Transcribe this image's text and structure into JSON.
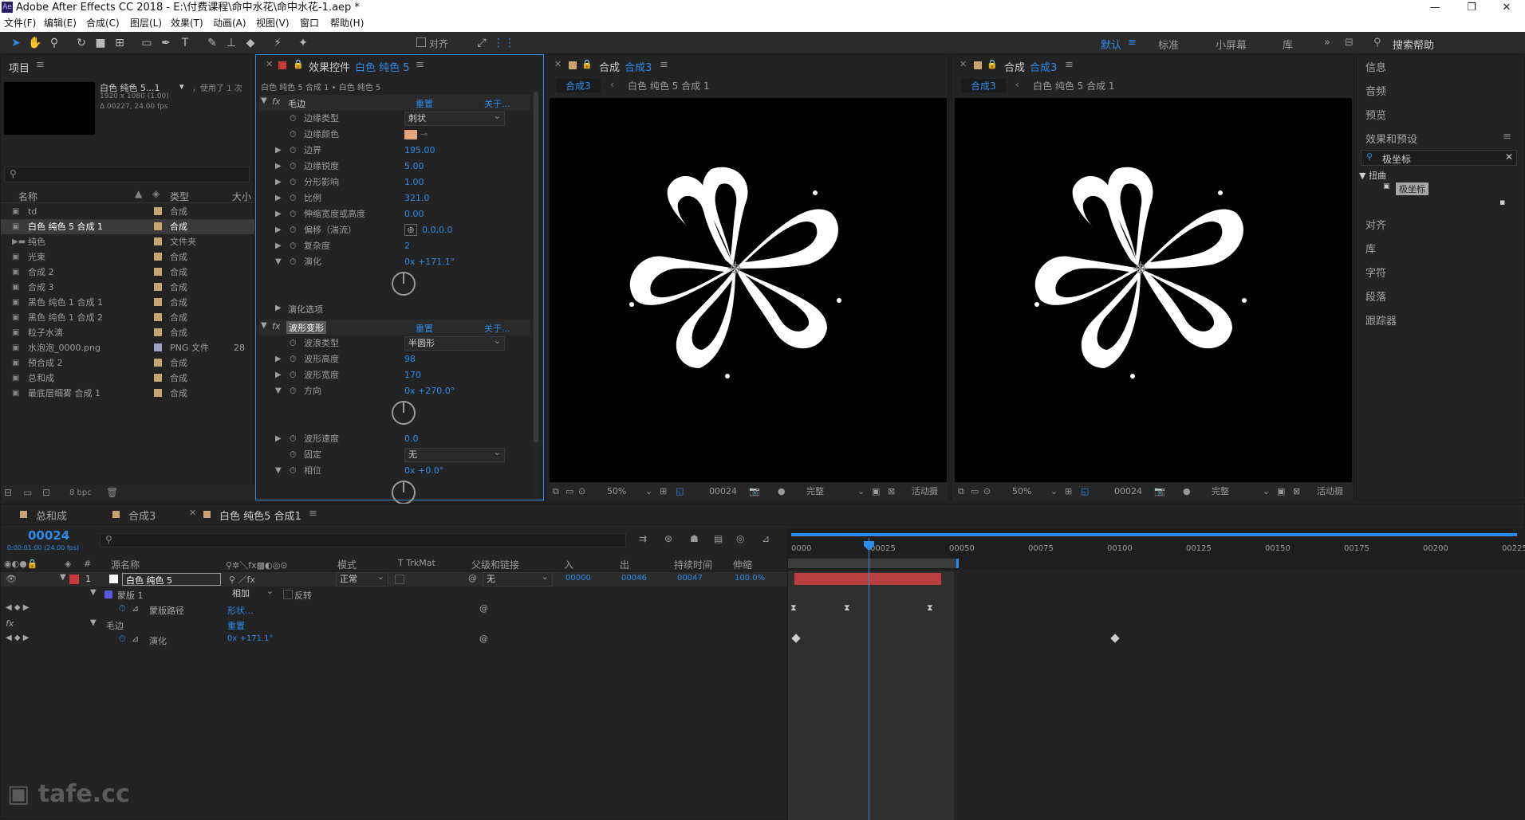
{
  "app": {
    "title": "Adobe After Effects CC 2018 - E:\\付费课程\\命中水花\\命中水花-1.aep *",
    "icon": "Ae"
  },
  "menu": [
    "文件(F)",
    "编辑(E)",
    "合成(C)",
    "图层(L)",
    "效果(T)",
    "动画(A)",
    "视图(V)",
    "窗口",
    "帮助(H)"
  ],
  "toolbar": {
    "align_label": "对齐",
    "workspaces": [
      "默认",
      "标准",
      "小屏幕",
      "库"
    ],
    "active_workspace": "默认",
    "search_help": "搜索帮助"
  },
  "project": {
    "tab": "项目",
    "item_name": "白色 纯色 5...1",
    "used": "，使用了 1 次",
    "dims": "1920 x 1080 (1.00)",
    "duration": "Δ 00227, 24.00 fps",
    "columns": [
      "名称",
      "类型",
      "大小"
    ],
    "items": [
      {
        "name": "td",
        "type": "合成",
        "size": "",
        "color": "#c8a56e",
        "selected": false
      },
      {
        "name": "白色 纯色 5 合成 1",
        "type": "合成",
        "size": "",
        "color": "#c8a56e",
        "selected": true
      },
      {
        "name": "纯色",
        "type": "文件夹",
        "size": "",
        "color": "#c8a56e",
        "selected": false
      },
      {
        "name": "光束",
        "type": "合成",
        "size": "",
        "color": "#c8a56e",
        "selected": false
      },
      {
        "name": "合成 2",
        "type": "合成",
        "size": "",
        "color": "#c8a56e",
        "selected": false
      },
      {
        "name": "合成 3",
        "type": "合成",
        "size": "",
        "color": "#c8a56e",
        "selected": false
      },
      {
        "name": "黑色 纯色 1 合成 1",
        "type": "合成",
        "size": "",
        "color": "#c8a56e",
        "selected": false
      },
      {
        "name": "黑色 纯色 1 合成 2",
        "type": "合成",
        "size": "",
        "color": "#c8a56e",
        "selected": false
      },
      {
        "name": "粒子水滴",
        "type": "合成",
        "size": "",
        "color": "#c8a56e",
        "selected": false
      },
      {
        "name": "水泡泡_0000.png",
        "type": "PNG 文件",
        "size": "28",
        "color": "#9fa0c8",
        "selected": false
      },
      {
        "name": "预合成 2",
        "type": "合成",
        "size": "",
        "color": "#c8a56e",
        "selected": false
      },
      {
        "name": "总和成",
        "type": "合成",
        "size": "",
        "color": "#c8a56e",
        "selected": false
      },
      {
        "name": "最底层细雾 合成 1",
        "type": "合成",
        "size": "",
        "color": "#c8a56e",
        "selected": false
      }
    ],
    "bpc": "8 bpc"
  },
  "effects": {
    "tab": "效果控件",
    "layer": "白色 纯色 5",
    "breadcrumb": "白色 纯色 5 合成 1 • 白色 纯色 5",
    "fx1": {
      "name": "毛边",
      "reset": "重置",
      "about": "关于...",
      "props": [
        {
          "name": "边缘类型",
          "value": "刺状",
          "kind": "dropdown"
        },
        {
          "name": "边缘颜色",
          "value": "",
          "kind": "color"
        },
        {
          "name": "边界",
          "value": "195.00",
          "kind": "num"
        },
        {
          "name": "边缘锐度",
          "value": "5.00",
          "kind": "num"
        },
        {
          "name": "分形影响",
          "value": "1.00",
          "kind": "num"
        },
        {
          "name": "比例",
          "value": "321.0",
          "kind": "num"
        },
        {
          "name": "伸缩宽度或高度",
          "value": "0.00",
          "kind": "num"
        },
        {
          "name": "偏移（湍流）",
          "value": "0.0,0.0",
          "kind": "point"
        },
        {
          "name": "复杂度",
          "value": "2",
          "kind": "num"
        },
        {
          "name": "演化",
          "value": "0x +171.1°",
          "kind": "angle"
        }
      ],
      "options": "演化选项"
    },
    "fx2": {
      "name": "波形变形",
      "reset": "重置",
      "about": "关于...",
      "props": [
        {
          "name": "波浪类型",
          "value": "半圆形",
          "kind": "dropdown"
        },
        {
          "name": "波形高度",
          "value": "98",
          "kind": "num"
        },
        {
          "name": "波形宽度",
          "value": "170",
          "kind": "num"
        },
        {
          "name": "方向",
          "value": "0x +270.0°",
          "kind": "angle"
        },
        {
          "name": "波形速度",
          "value": "0.0",
          "kind": "num"
        },
        {
          "name": "固定",
          "value": "无",
          "kind": "dropdown"
        },
        {
          "name": "相位",
          "value": "0x +0.0°",
          "kind": "angle"
        }
      ]
    }
  },
  "viewer1": {
    "tab_prefix": "合成",
    "tab": "合成3",
    "crumbs": [
      "合成3",
      "白色 纯色 5 合成 1"
    ],
    "zoom": "50%",
    "time": "00024",
    "quality": "完整",
    "camera": "活动摄"
  },
  "viewer2": {
    "tab_prefix": "合成",
    "tab": "合成3",
    "crumbs": [
      "合成3",
      "白色 纯色 5 合成 1"
    ],
    "zoom": "50%",
    "time": "00024",
    "quality": "完整",
    "camera": "活动摄"
  },
  "right_panel": {
    "items": [
      "信息",
      "音频",
      "预览",
      "效果和预设",
      "对齐",
      "库",
      "字符",
      "段落",
      "跟踪器"
    ],
    "search": "极坐标",
    "category": "扭曲",
    "result": "极坐标"
  },
  "timeline": {
    "tabs": [
      "总和成",
      "合成3",
      "白色 纯色5 合成1"
    ],
    "timecode": "00024",
    "fps": "0:00:01:00 (24.00 fps)",
    "cols": [
      "源名称",
      "模式",
      "T TrkMat",
      "父级和链接",
      "入",
      "出",
      "持续时间",
      "伸缩"
    ],
    "layer": {
      "num": "1",
      "name": "白色 纯色 5",
      "mode": "正常",
      "parent": "无",
      "in": "00000",
      "out": "00046",
      "dur": "00047",
      "stretch": "100.0%"
    },
    "mask": {
      "name": "蒙版 1",
      "mode": "相加",
      "invert": "反转",
      "path_label": "蒙版路径",
      "path_val": "形状..."
    },
    "fx": {
      "name": "毛边",
      "reset": "重置",
      "prop": "演化",
      "val": "0x +171.1°"
    },
    "ruler": [
      "0000",
      "00025",
      "00050",
      "00075",
      "00100",
      "00125",
      "00150",
      "00175",
      "00200",
      "00225"
    ]
  },
  "watermark": "tafe.cc",
  "colors": {
    "accent": "#2d8ceb",
    "layer_bar": "#b8403f",
    "label_red": "#c83a3a"
  }
}
